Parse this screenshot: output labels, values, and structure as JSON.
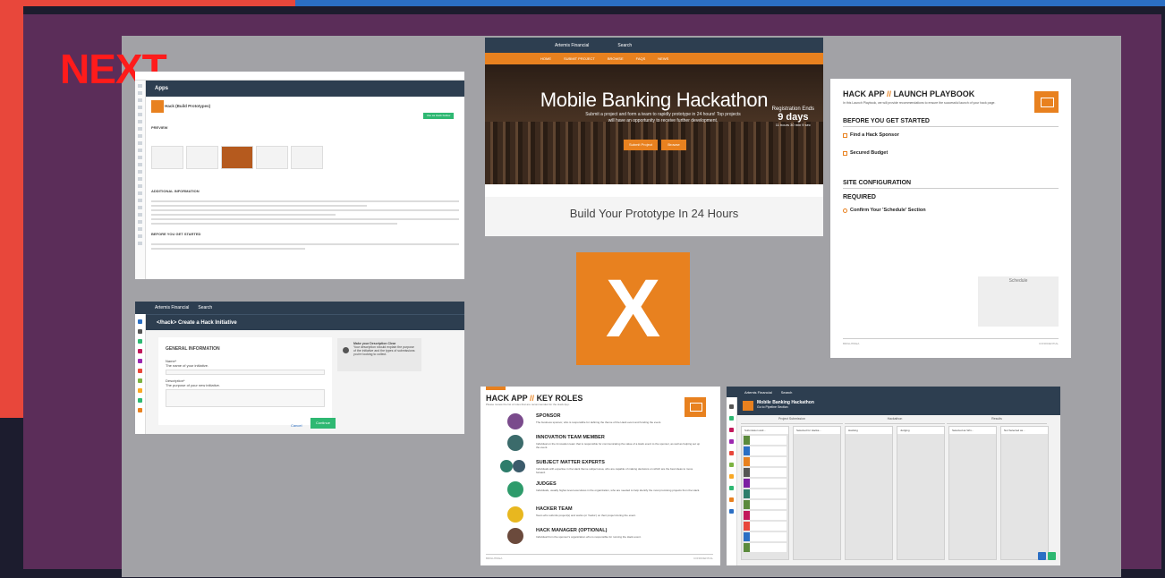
{
  "overlay": {
    "next_label": "NEXT",
    "center_logo": "X"
  },
  "apps_card": {
    "apps_title": "Apps",
    "hack_title": "Hack (Build Prototypes)",
    "use_button": "Use as Hack Fellow",
    "preview_heading": "PREVIEW",
    "additional_heading": "ADDITIONAL INFORMATION",
    "before_heading": "BEFORE YOU GET STARTED"
  },
  "hackathon_card": {
    "brand": "Artemis Financial",
    "search": "Search",
    "nav": [
      "HOME",
      "SUBMIT PROJECT",
      "BROWSE",
      "FAQS",
      "NEWS"
    ],
    "title": "Mobile Banking Hackathon",
    "subtitle": "Submit a project and form a team to rapidly prototype in 24 hours! Top projects will have an opportunity to receive further development.",
    "submit_button": "Submit Project",
    "browse_button": "Browse",
    "registration_label": "Registration Ends",
    "registration_days": "9 days",
    "registration_detail": "11 hours 30 min 9 sec",
    "footer_text": "Build Your Prototype In 24 Hours"
  },
  "playbook_card": {
    "title_a": "HACK APP",
    "slashes": "//",
    "title_b": "LAUNCH PLAYBOOK",
    "intro": "In this Launch Playbook, we will provide recommendations to ensure the successful launch of your hack page.",
    "before_heading": "BEFORE YOU GET STARTED",
    "find_sponsor": "Find a Hack Sponsor",
    "secured_budget": "Secured Budget",
    "site_config": "SITE CONFIGURATION",
    "required": "REQUIRED",
    "confirm_schedule": "Confirm Your 'Schedule' Section",
    "schedule_label": "Schedule",
    "footer_left": "BRIGHTIDEA",
    "footer_right": "CONFIDENTIAL"
  },
  "create_card": {
    "brand": "Artemis Financial",
    "search": "Search",
    "page_title": "</hack>  Create a Hack Initiative",
    "general_info": "GENERAL INFORMATION",
    "name_label": "Name*",
    "name_hint": "The name of your initiative.",
    "description_label": "Description*",
    "description_hint": "The purpose of your new initiative.",
    "tip_title": "Make your Description Clear",
    "tip_text": "Your description should explain the purpose of the initiative and the types of submissions you're looking to collect.",
    "cancel_button": "Cancel",
    "continue_button": "Continue"
  },
  "roles_card": {
    "title_a": "HACK APP",
    "slashes": "//",
    "title_b": "KEY ROLES",
    "subtitle": "Please review the list of roles that are recommended for the Hack App.",
    "roles": [
      {
        "name": "SPONSOR",
        "desc": "The business sponsor, who is responsible for defining the theme of the Hack event and funding the event."
      },
      {
        "name": "INNOVATION TEAM MEMBER",
        "desc": "Individual on the Innovation team that is responsible for communicating the value of a Hack event to the sponsor, as well as helping set up the event."
      },
      {
        "name": "SUBJECT MATTER EXPERTS",
        "desc": "Individuals with expertise in the Hack theme subject area, who are capable of making decisions on which are the best ideas to move forward."
      },
      {
        "name": "JUDGES",
        "desc": "Individuals, usually higher-level executives in the organization, who are needed to help identify the most promising projects from the Hack."
      },
      {
        "name": "HACKER TEAM",
        "desc": "Team who submits project(s) and works (or 'hacks') on their project during the event."
      },
      {
        "name": "HACK MANAGER (OPTIONAL)",
        "desc": "Individual from the sponsor's organization who is responsible for running the Hack event."
      }
    ],
    "footer_left": "BRIGHTIDEA",
    "footer_right": "CONFIDENTIAL"
  },
  "board_card": {
    "brand": "Artemis Financial",
    "search": "Search",
    "title": "Mobile Banking Hackathon",
    "subtitle": "Go to Pipeline Section",
    "groups": [
      "Project Submission",
      "Hackathon",
      "Results"
    ],
    "columns": [
      "Submission and...",
      "Selected for Hacka...",
      "Hacking",
      "Judging",
      "Selected as Win...",
      "Not Selected as..."
    ]
  },
  "colors": {
    "orange": "#e8811f",
    "navy": "#2d3e50",
    "green": "#2eb872",
    "purple": "#5b2d59",
    "red": "#ff1b1b"
  }
}
